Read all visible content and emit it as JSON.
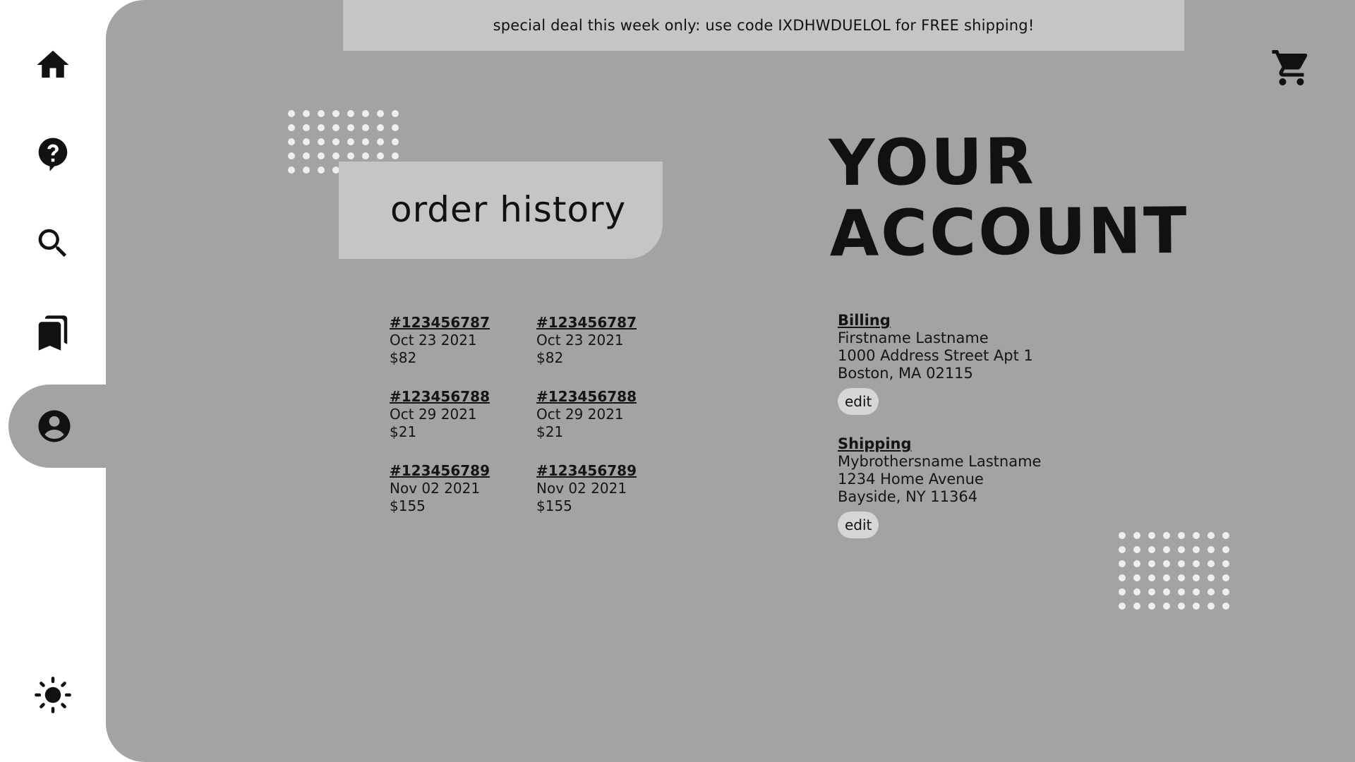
{
  "promo": {
    "text": "special deal this week only: use code IXDHWDUELOL for FREE shipping!"
  },
  "sidebar": {
    "items": [
      {
        "icon": "home-icon"
      },
      {
        "icon": "help-icon"
      },
      {
        "icon": "search-icon"
      },
      {
        "icon": "bookmarks-icon"
      },
      {
        "icon": "account-icon",
        "active": true
      }
    ],
    "theme_icon": "sun-icon"
  },
  "cart": {
    "icon": "cart-icon"
  },
  "order_history": {
    "title": "order history",
    "columns": [
      [
        {
          "number": "#123456787",
          "date": "Oct 23 2021",
          "amount": "$82"
        },
        {
          "number": "#123456788",
          "date": "Oct 29 2021",
          "amount": "$21"
        },
        {
          "number": "#123456789",
          "date": "Nov 02 2021",
          "amount": "$155"
        }
      ],
      [
        {
          "number": "#123456787",
          "date": "Oct 23 2021",
          "amount": "$82"
        },
        {
          "number": "#123456788",
          "date": "Oct 29 2021",
          "amount": "$21"
        },
        {
          "number": "#123456789",
          "date": "Nov 02 2021",
          "amount": "$155"
        }
      ]
    ]
  },
  "account": {
    "title_line1": "YOUR",
    "title_line2": "ACCOUNT",
    "billing": {
      "heading": "Billing",
      "name": "Firstname Lastname",
      "street": "1000 Address Street Apt 1",
      "city": "Boston, MA 02115",
      "edit_label": "edit"
    },
    "shipping": {
      "heading": "Shipping",
      "name": "Mybrothersname Lastname",
      "street": "1234 Home Avenue",
      "city": "Bayside, NY 11364",
      "edit_label": "edit"
    }
  },
  "colors": {
    "panel": "#a3a3a3",
    "banner": "#c5c5c5",
    "sidebar": "#ffffff",
    "dots": "#eeeeee"
  }
}
